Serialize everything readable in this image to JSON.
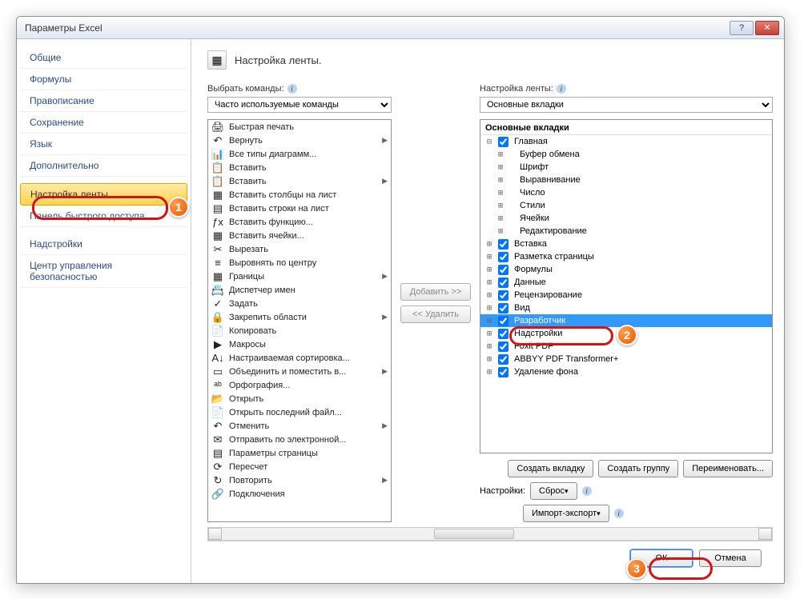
{
  "window": {
    "title": "Параметры Excel"
  },
  "sidebar": {
    "items": [
      {
        "label": "Общие",
        "selected": false
      },
      {
        "label": "Формулы",
        "selected": false
      },
      {
        "label": "Правописание",
        "selected": false
      },
      {
        "label": "Сохранение",
        "selected": false
      },
      {
        "label": "Язык",
        "selected": false
      },
      {
        "label": "Дополнительно",
        "selected": false
      },
      {
        "label": "Настройка ленты",
        "selected": true
      },
      {
        "label": "Панель быстрого доступа",
        "selected": false
      },
      {
        "label": "Надстройки",
        "selected": false
      },
      {
        "label": "Центр управления безопасностью",
        "selected": false
      }
    ]
  },
  "header": {
    "title": "Настройка ленты."
  },
  "left": {
    "label": "Выбрать команды:",
    "combo_value": "Часто используемые команды",
    "commands": [
      {
        "icon": "🖨",
        "label": "Быстрая печать",
        "sub": false
      },
      {
        "icon": "↶",
        "label": "Вернуть",
        "sub": true
      },
      {
        "icon": "📊",
        "label": "Все типы диаграмм...",
        "sub": false
      },
      {
        "icon": "📋",
        "label": "Вставить",
        "sub": false
      },
      {
        "icon": "📋",
        "label": "Вставить",
        "sub": true
      },
      {
        "icon": "▦",
        "label": "Вставить столбцы на лист",
        "sub": false
      },
      {
        "icon": "▤",
        "label": "Вставить строки на лист",
        "sub": false
      },
      {
        "icon": "ƒx",
        "label": "Вставить функцию...",
        "sub": false
      },
      {
        "icon": "▦",
        "label": "Вставить ячейки...",
        "sub": false
      },
      {
        "icon": "✂",
        "label": "Вырезать",
        "sub": false
      },
      {
        "icon": "≡",
        "label": "Выровнять по центру",
        "sub": false
      },
      {
        "icon": "▦",
        "label": "Границы",
        "sub": true
      },
      {
        "icon": "📇",
        "label": "Диспетчер имен",
        "sub": false
      },
      {
        "icon": "✓",
        "label": "Задать",
        "sub": false
      },
      {
        "icon": "🔒",
        "label": "Закрепить области",
        "sub": true
      },
      {
        "icon": "📄",
        "label": "Копировать",
        "sub": false
      },
      {
        "icon": "▶",
        "label": "Макросы",
        "sub": false
      },
      {
        "icon": "A↓",
        "label": "Настраиваемая сортировка...",
        "sub": false
      },
      {
        "icon": "▭",
        "label": "Объединить и поместить в...",
        "sub": true
      },
      {
        "icon": "ᵃᵇ",
        "label": "Орфография...",
        "sub": false
      },
      {
        "icon": "📂",
        "label": "Открыть",
        "sub": false
      },
      {
        "icon": "📄",
        "label": "Открыть последний файл...",
        "sub": false
      },
      {
        "icon": "↶",
        "label": "Отменить",
        "sub": true
      },
      {
        "icon": "✉",
        "label": "Отправить по электронной...",
        "sub": false
      },
      {
        "icon": "▤",
        "label": "Параметры страницы",
        "sub": false
      },
      {
        "icon": "⟳",
        "label": "Пересчет",
        "sub": false
      },
      {
        "icon": "↻",
        "label": "Повторить",
        "sub": true
      },
      {
        "icon": "🔗",
        "label": "Подключения",
        "sub": false
      }
    ]
  },
  "mid": {
    "add_label": "Добавить >>",
    "remove_label": "<< Удалить"
  },
  "right": {
    "label": "Настройка ленты:",
    "combo_value": "Основные вкладки",
    "tree_header": "Основные вкладки",
    "nodes": [
      {
        "depth": 0,
        "twist": "⊟",
        "check": true,
        "label": "Главная",
        "sel": false
      },
      {
        "depth": 1,
        "twist": "⊞",
        "check": null,
        "label": "Буфер обмена",
        "sel": false
      },
      {
        "depth": 1,
        "twist": "⊞",
        "check": null,
        "label": "Шрифт",
        "sel": false
      },
      {
        "depth": 1,
        "twist": "⊞",
        "check": null,
        "label": "Выравнивание",
        "sel": false
      },
      {
        "depth": 1,
        "twist": "⊞",
        "check": null,
        "label": "Число",
        "sel": false
      },
      {
        "depth": 1,
        "twist": "⊞",
        "check": null,
        "label": "Стили",
        "sel": false
      },
      {
        "depth": 1,
        "twist": "⊞",
        "check": null,
        "label": "Ячейки",
        "sel": false
      },
      {
        "depth": 1,
        "twist": "⊞",
        "check": null,
        "label": "Редактирование",
        "sel": false
      },
      {
        "depth": 0,
        "twist": "⊞",
        "check": true,
        "label": "Вставка",
        "sel": false
      },
      {
        "depth": 0,
        "twist": "⊞",
        "check": true,
        "label": "Разметка страницы",
        "sel": false
      },
      {
        "depth": 0,
        "twist": "⊞",
        "check": true,
        "label": "Формулы",
        "sel": false
      },
      {
        "depth": 0,
        "twist": "⊞",
        "check": true,
        "label": "Данные",
        "sel": false
      },
      {
        "depth": 0,
        "twist": "⊞",
        "check": true,
        "label": "Рецензирование",
        "sel": false
      },
      {
        "depth": 0,
        "twist": "⊞",
        "check": true,
        "label": "Вид",
        "sel": false
      },
      {
        "depth": 0,
        "twist": "⊞",
        "check": true,
        "label": "Разработчик",
        "sel": true
      },
      {
        "depth": 0,
        "twist": "⊞",
        "check": true,
        "label": "Надстройки",
        "sel": false
      },
      {
        "depth": 0,
        "twist": "⊞",
        "check": true,
        "label": "Foxit PDF",
        "sel": false
      },
      {
        "depth": 0,
        "twist": "⊞",
        "check": true,
        "label": "ABBYY PDF Transformer+",
        "sel": false
      },
      {
        "depth": 0,
        "twist": "⊞",
        "check": true,
        "label": "Удаление фона",
        "sel": false
      }
    ],
    "buttons": {
      "new_tab": "Создать вкладку",
      "new_group": "Создать группу",
      "rename": "Переименовать...",
      "settings_label": "Настройки:",
      "reset": "Сброс",
      "import_export": "Импорт-экспорт"
    }
  },
  "footer": {
    "ok": "ОК",
    "cancel": "Отмена"
  },
  "callouts": {
    "n1": "1",
    "n2": "2",
    "n3": "3"
  }
}
